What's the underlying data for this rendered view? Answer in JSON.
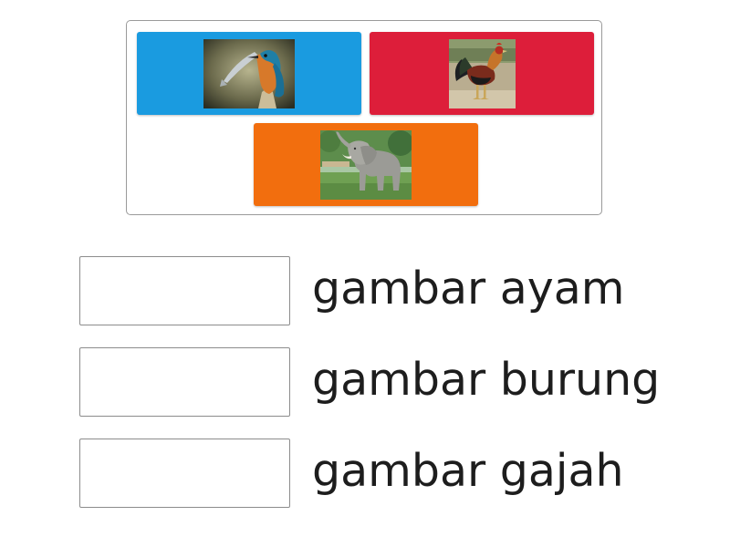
{
  "tiles": [
    {
      "icon": "kingfisher-image",
      "color": "#1a9be0"
    },
    {
      "icon": "rooster-image",
      "color": "#dd1e3a"
    },
    {
      "icon": "elephant-image",
      "color": "#f26e0e"
    }
  ],
  "targets": [
    {
      "label": "gambar ayam"
    },
    {
      "label": "gambar burung"
    },
    {
      "label": "gambar gajah"
    }
  ]
}
